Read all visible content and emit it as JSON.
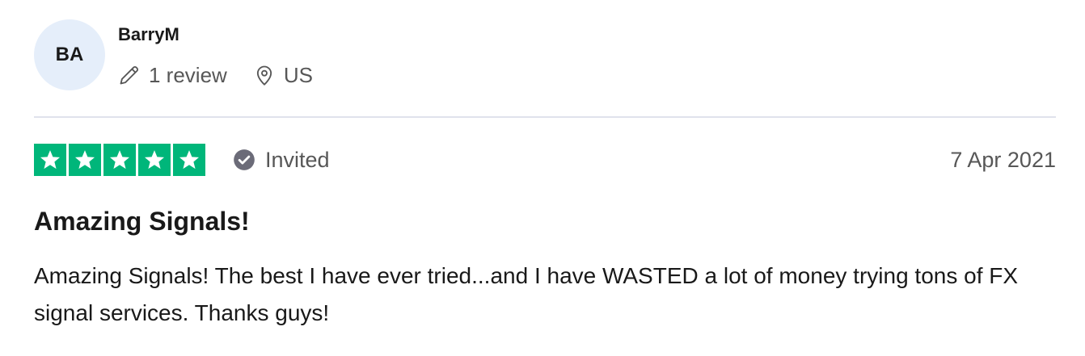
{
  "reviewer": {
    "initials": "BA",
    "name": "BarryM",
    "review_count": "1 review",
    "location": "US",
    "icons": {
      "reviews": "pencil-icon",
      "location": "location-pin-icon"
    }
  },
  "review": {
    "rating": 5,
    "max_rating": 5,
    "status": "Invited",
    "status_icon": "check-circle-icon",
    "date": "7 Apr 2021",
    "title": "Amazing Signals!",
    "body": "Amazing Signals! The best I have ever tried...and I have WASTED a lot of money trying tons of FX signal services. Thanks guys!"
  },
  "colors": {
    "star_fill": "#00b67a",
    "avatar_bg": "#e5eefa",
    "muted_text": "#575757",
    "divider": "#e0e2ec"
  }
}
